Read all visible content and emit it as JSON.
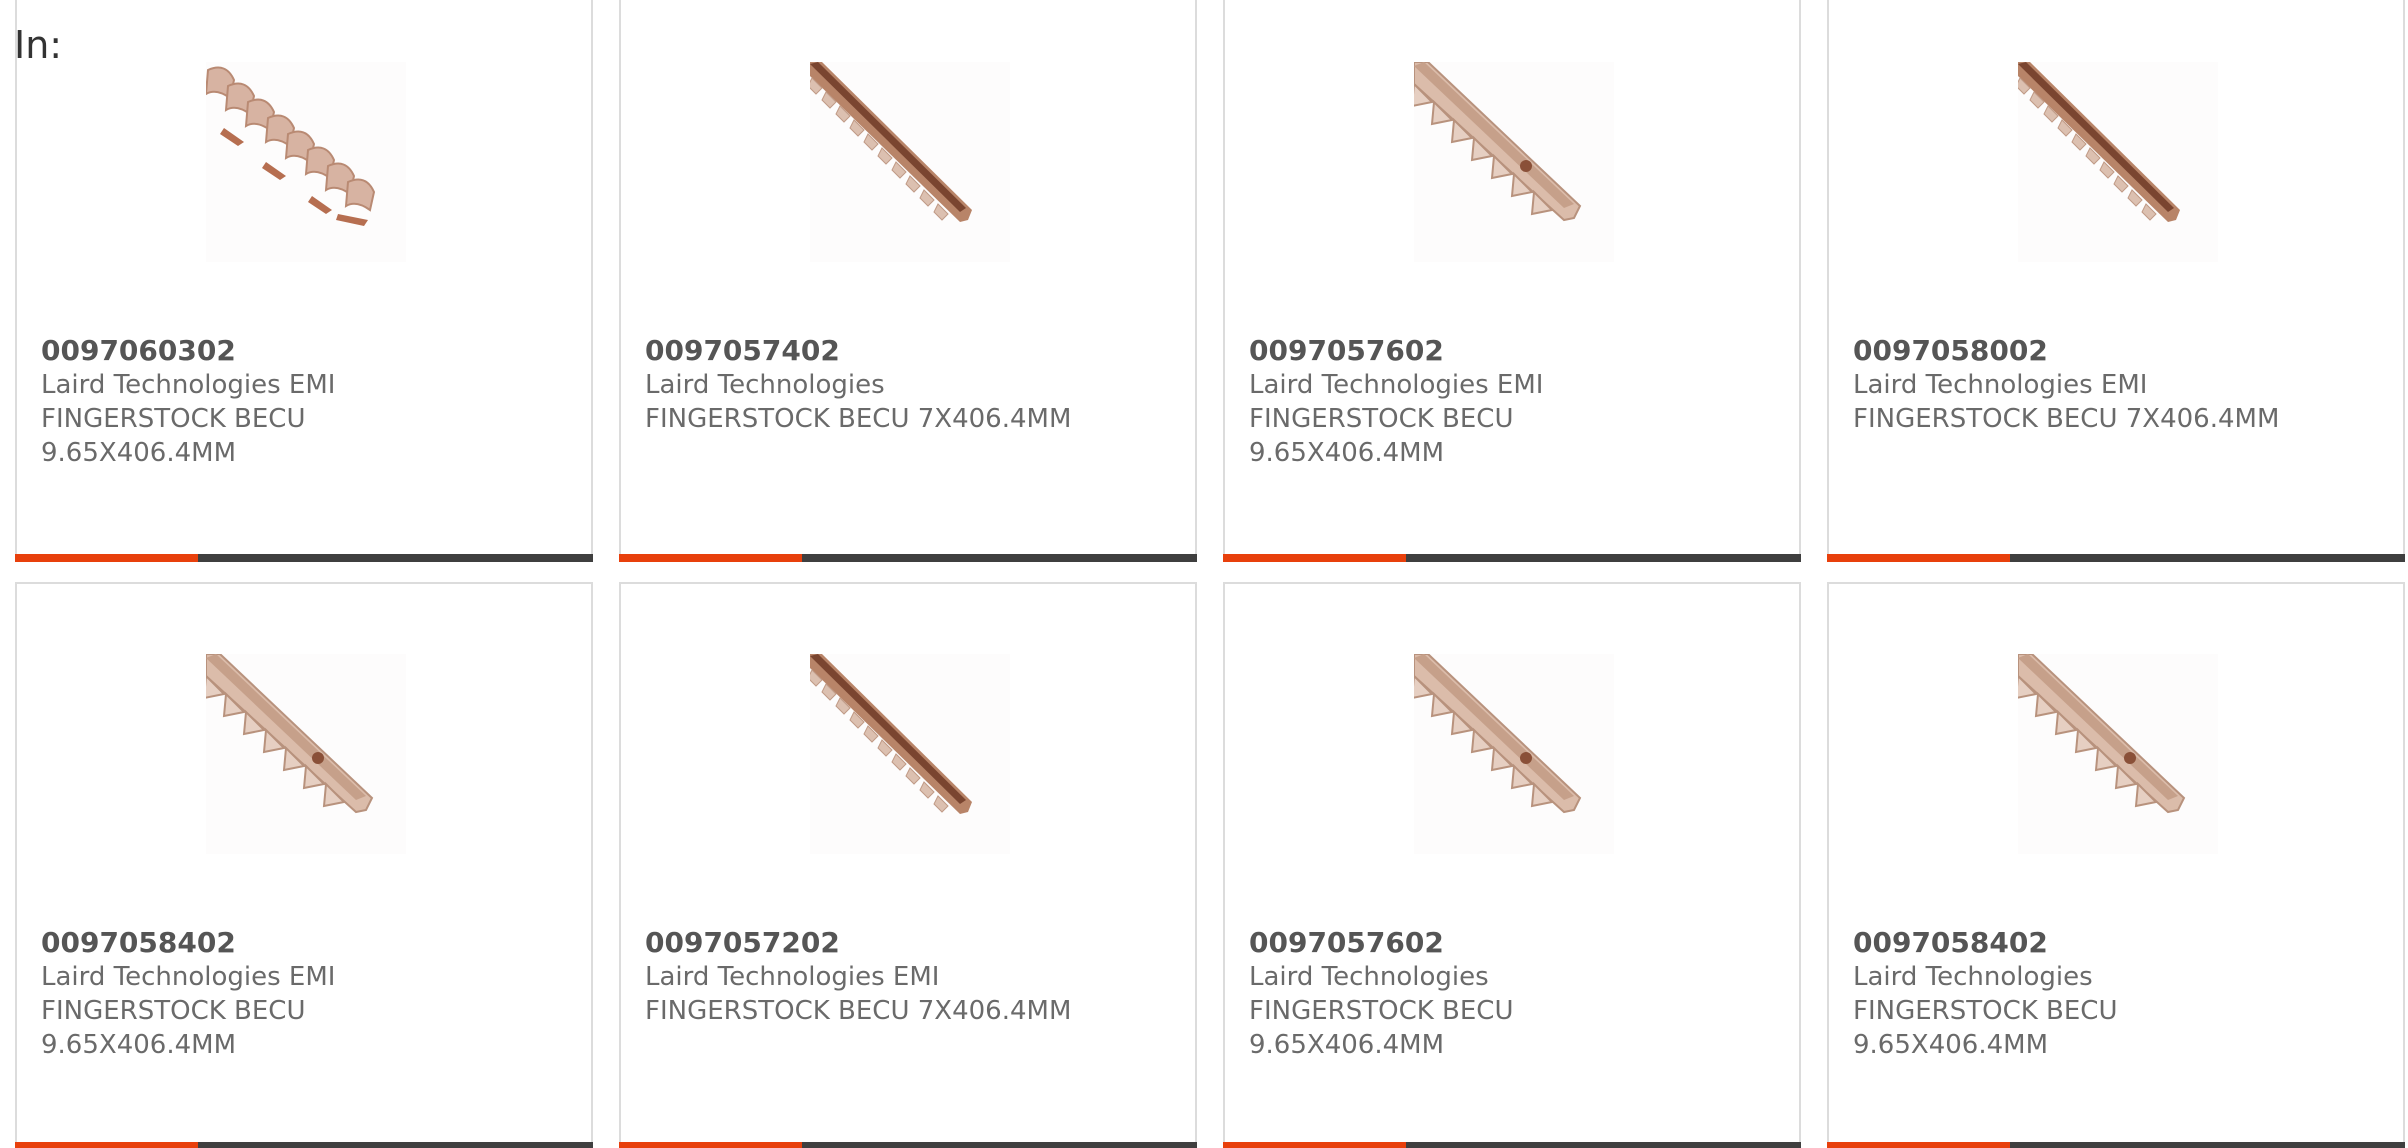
{
  "header": {
    "label": "In:"
  },
  "colors": {
    "accent": "#e8400c",
    "bar": "#3f3f3f",
    "copper": "#c8957a"
  },
  "products": [
    {
      "part": "0097060302",
      "lines": [
        "Laird Technologies EMI",
        "FINGERSTOCK BECU",
        "9.65X406.4MM"
      ],
      "image": "coiled-fingerstock-image"
    },
    {
      "part": "0097057402",
      "lines": [
        "Laird Technologies",
        "FINGERSTOCK BECU 7X406.4MM"
      ],
      "image": "straight-fingerstock-image"
    },
    {
      "part": "0097057602",
      "lines": [
        "Laird Technologies EMI",
        "FINGERSTOCK BECU",
        "9.65X406.4MM"
      ],
      "image": "toothed-fingerstock-image"
    },
    {
      "part": "0097058002",
      "lines": [
        "Laird Technologies EMI",
        "FINGERSTOCK BECU 7X406.4MM"
      ],
      "image": "straight-fingerstock-image"
    },
    {
      "part": "0097058402",
      "lines": [
        "Laird Technologies EMI",
        "FINGERSTOCK BECU",
        "9.65X406.4MM"
      ],
      "image": "toothed-fingerstock-image"
    },
    {
      "part": "0097057202",
      "lines": [
        "Laird Technologies EMI",
        "FINGERSTOCK BECU 7X406.4MM"
      ],
      "image": "straight-fingerstock-image"
    },
    {
      "part": "0097057602",
      "lines": [
        "Laird Technologies",
        "FINGERSTOCK BECU",
        "9.65X406.4MM"
      ],
      "image": "toothed-fingerstock-image"
    },
    {
      "part": "0097058402",
      "lines": [
        "Laird Technologies",
        "FINGERSTOCK BECU",
        "9.65X406.4MM"
      ],
      "image": "toothed-fingerstock-image"
    }
  ]
}
